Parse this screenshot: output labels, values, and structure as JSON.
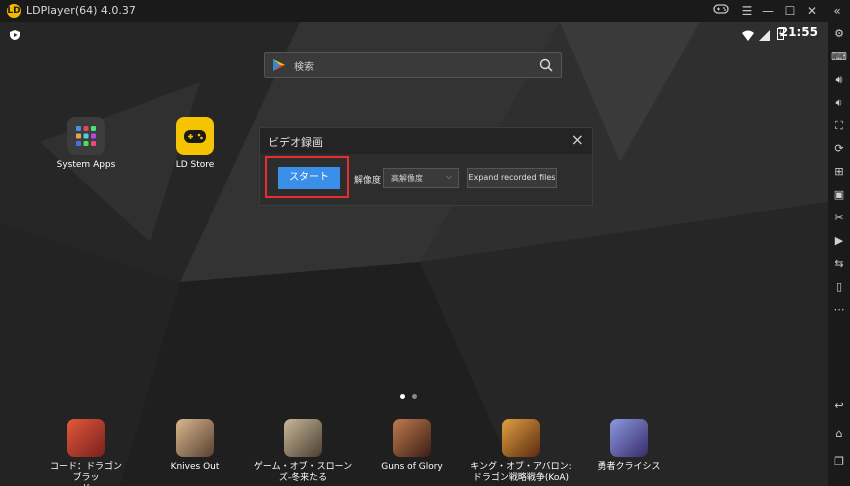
{
  "window": {
    "title": "LDPlayer(64) 4.0.37",
    "controls": [
      "gamepad-icon",
      "menu-icon",
      "minimize-icon",
      "maximize-icon",
      "close-icon",
      "collapse-icon"
    ]
  },
  "status": {
    "time": "21:55"
  },
  "search": {
    "placeholder": "検索"
  },
  "desktop_apps": [
    {
      "label": "System Apps"
    },
    {
      "label": "LD Store"
    }
  ],
  "dialog": {
    "title": "ビデオ録画",
    "start_label": "スタート",
    "resolution_label": "解像度",
    "resolution_value": "高解像度",
    "expand_label": "Expand recorded files"
  },
  "dock": [
    {
      "line1": "コード：ドラゴンブラッ",
      "line2": "ド",
      "color": "#c0392b"
    },
    {
      "line1": "Knives Out",
      "line2": "",
      "color": "#a08560"
    },
    {
      "line1": "ゲーム・オブ・スローン",
      "line2": "ズ-冬来たる",
      "color": "#8a7a68"
    },
    {
      "line1": "Guns of Glory",
      "line2": "",
      "color": "#8b4a2e"
    },
    {
      "line1": "キング・オブ・アバロン:",
      "line2": "ドラゴン戦略戦争(KoA)",
      "color": "#9a5a28"
    },
    {
      "line1": "勇者クライシス",
      "line2": "",
      "color": "#5a5fa8"
    }
  ],
  "colors": {
    "accent": "#3a8fe8",
    "highlight": "#e52e2e",
    "ld_yellow": "#f5c400"
  }
}
